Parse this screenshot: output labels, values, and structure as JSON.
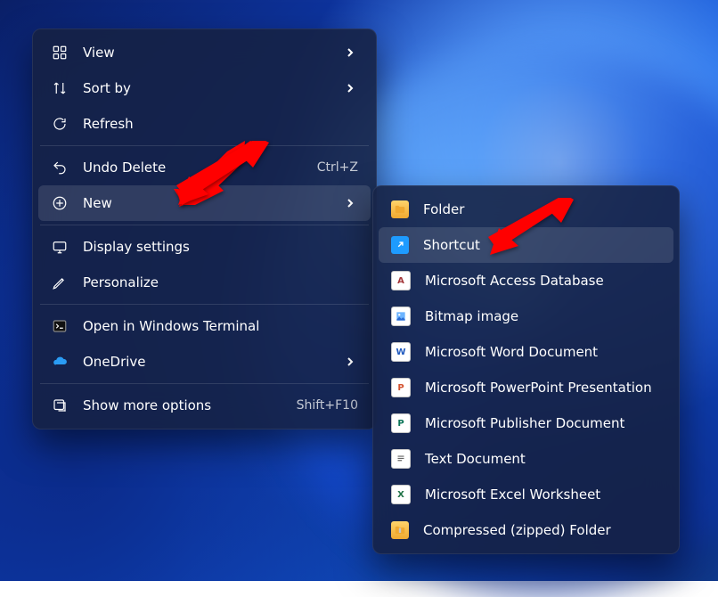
{
  "context_menu": {
    "groups": [
      {
        "items": [
          {
            "icon": "grid-icon",
            "label": "View",
            "shortcut": "",
            "hasSubmenu": true,
            "selected": false
          },
          {
            "icon": "sort-icon",
            "label": "Sort by",
            "shortcut": "",
            "hasSubmenu": true,
            "selected": false
          },
          {
            "icon": "refresh-icon",
            "label": "Refresh",
            "shortcut": "",
            "hasSubmenu": false,
            "selected": false
          }
        ]
      },
      {
        "items": [
          {
            "icon": "undo-icon",
            "label": "Undo Delete",
            "shortcut": "Ctrl+Z",
            "hasSubmenu": false,
            "selected": false
          },
          {
            "icon": "new-icon",
            "label": "New",
            "shortcut": "",
            "hasSubmenu": true,
            "selected": true
          }
        ]
      },
      {
        "items": [
          {
            "icon": "display-icon",
            "label": "Display settings",
            "shortcut": "",
            "hasSubmenu": false,
            "selected": false
          },
          {
            "icon": "personalize-icon",
            "label": "Personalize",
            "shortcut": "",
            "hasSubmenu": false,
            "selected": false
          }
        ]
      },
      {
        "items": [
          {
            "icon": "terminal-icon",
            "label": "Open in Windows Terminal",
            "shortcut": "",
            "hasSubmenu": false,
            "selected": false
          },
          {
            "icon": "onedrive-icon",
            "label": "OneDrive",
            "shortcut": "",
            "hasSubmenu": true,
            "selected": false
          }
        ]
      },
      {
        "items": [
          {
            "icon": "more-icon",
            "label": "Show more options",
            "shortcut": "Shift+F10",
            "hasSubmenu": false,
            "selected": false
          }
        ]
      }
    ]
  },
  "submenu": {
    "items": [
      {
        "icon": "folder",
        "label": "Folder",
        "selected": false
      },
      {
        "icon": "shortcut",
        "label": "Shortcut",
        "selected": true
      },
      {
        "icon": "access",
        "label": "Microsoft Access Database",
        "selected": false
      },
      {
        "icon": "bmp",
        "label": "Bitmap image",
        "selected": false
      },
      {
        "icon": "word",
        "label": "Microsoft Word Document",
        "selected": false
      },
      {
        "icon": "ppt",
        "label": "Microsoft PowerPoint Presentation",
        "selected": false
      },
      {
        "icon": "pub",
        "label": "Microsoft Publisher Document",
        "selected": false
      },
      {
        "icon": "txt",
        "label": "Text Document",
        "selected": false
      },
      {
        "icon": "xls",
        "label": "Microsoft Excel Worksheet",
        "selected": false
      },
      {
        "icon": "zip",
        "label": "Compressed (zipped) Folder",
        "selected": false
      }
    ]
  },
  "annotations": {
    "arrow1_target": "New",
    "arrow2_target": "Shortcut",
    "arrow_color": "#ff0000"
  }
}
